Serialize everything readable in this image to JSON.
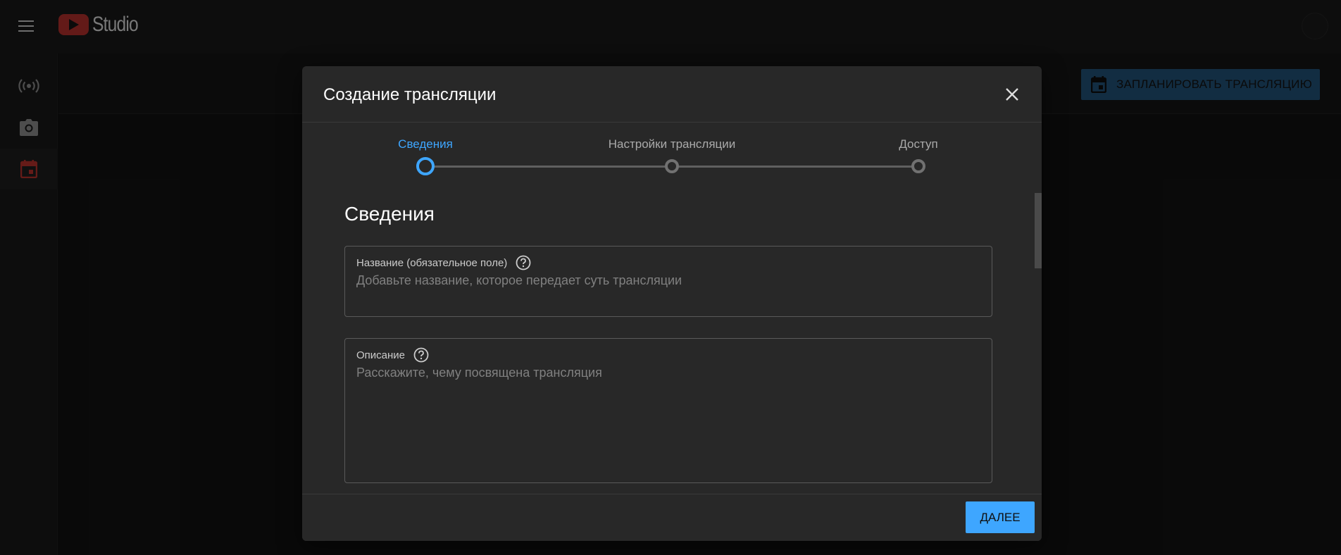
{
  "app": {
    "logo_text": "Studio"
  },
  "toolbar": {
    "schedule_label": "ЗАПЛАНИРОВАТЬ ТРАНСЛЯЦИЮ"
  },
  "sidebar": {
    "items": [
      {
        "icon": "broadcast-icon"
      },
      {
        "icon": "camera-icon"
      },
      {
        "icon": "calendar-icon",
        "active": true
      }
    ]
  },
  "dialog": {
    "title": "Создание трансляции",
    "steps": [
      {
        "label": "Сведения",
        "active": true
      },
      {
        "label": "Настройки трансляции",
        "active": false
      },
      {
        "label": "Доступ",
        "active": false
      }
    ],
    "section_title": "Сведения",
    "fields": {
      "title": {
        "label": "Название (обязательное поле)",
        "value": "",
        "placeholder": "Добавьте название, которое передает суть трансляции"
      },
      "description": {
        "label": "Описание",
        "value": "",
        "placeholder": "Расскажите, чему посвящена трансляция"
      }
    },
    "next_label": "ДАЛЕЕ"
  },
  "colors": {
    "accent": "#3ea6ff",
    "dialog_bg": "#282828",
    "page_bg": "#0f0f0f"
  }
}
